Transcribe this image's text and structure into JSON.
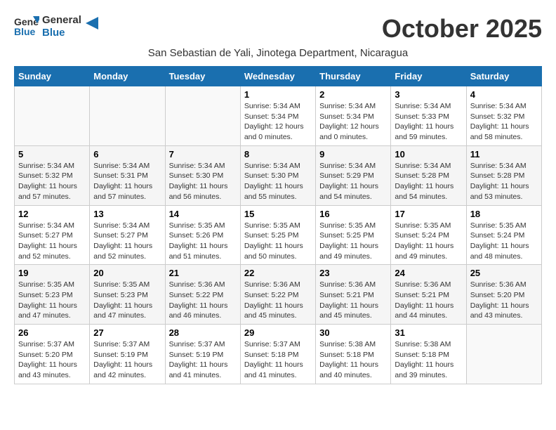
{
  "header": {
    "logo_general": "General",
    "logo_blue": "Blue",
    "month_title": "October 2025",
    "subtitle": "San Sebastian de Yali, Jinotega Department, Nicaragua"
  },
  "weekdays": [
    "Sunday",
    "Monday",
    "Tuesday",
    "Wednesday",
    "Thursday",
    "Friday",
    "Saturday"
  ],
  "weeks": [
    [
      {
        "day": "",
        "info": ""
      },
      {
        "day": "",
        "info": ""
      },
      {
        "day": "",
        "info": ""
      },
      {
        "day": "1",
        "info": "Sunrise: 5:34 AM\nSunset: 5:34 PM\nDaylight: 12 hours\nand 0 minutes."
      },
      {
        "day": "2",
        "info": "Sunrise: 5:34 AM\nSunset: 5:34 PM\nDaylight: 12 hours\nand 0 minutes."
      },
      {
        "day": "3",
        "info": "Sunrise: 5:34 AM\nSunset: 5:33 PM\nDaylight: 11 hours\nand 59 minutes."
      },
      {
        "day": "4",
        "info": "Sunrise: 5:34 AM\nSunset: 5:32 PM\nDaylight: 11 hours\nand 58 minutes."
      }
    ],
    [
      {
        "day": "5",
        "info": "Sunrise: 5:34 AM\nSunset: 5:32 PM\nDaylight: 11 hours\nand 57 minutes."
      },
      {
        "day": "6",
        "info": "Sunrise: 5:34 AM\nSunset: 5:31 PM\nDaylight: 11 hours\nand 57 minutes."
      },
      {
        "day": "7",
        "info": "Sunrise: 5:34 AM\nSunset: 5:30 PM\nDaylight: 11 hours\nand 56 minutes."
      },
      {
        "day": "8",
        "info": "Sunrise: 5:34 AM\nSunset: 5:30 PM\nDaylight: 11 hours\nand 55 minutes."
      },
      {
        "day": "9",
        "info": "Sunrise: 5:34 AM\nSunset: 5:29 PM\nDaylight: 11 hours\nand 54 minutes."
      },
      {
        "day": "10",
        "info": "Sunrise: 5:34 AM\nSunset: 5:28 PM\nDaylight: 11 hours\nand 54 minutes."
      },
      {
        "day": "11",
        "info": "Sunrise: 5:34 AM\nSunset: 5:28 PM\nDaylight: 11 hours\nand 53 minutes."
      }
    ],
    [
      {
        "day": "12",
        "info": "Sunrise: 5:34 AM\nSunset: 5:27 PM\nDaylight: 11 hours\nand 52 minutes."
      },
      {
        "day": "13",
        "info": "Sunrise: 5:34 AM\nSunset: 5:27 PM\nDaylight: 11 hours\nand 52 minutes."
      },
      {
        "day": "14",
        "info": "Sunrise: 5:35 AM\nSunset: 5:26 PM\nDaylight: 11 hours\nand 51 minutes."
      },
      {
        "day": "15",
        "info": "Sunrise: 5:35 AM\nSunset: 5:25 PM\nDaylight: 11 hours\nand 50 minutes."
      },
      {
        "day": "16",
        "info": "Sunrise: 5:35 AM\nSunset: 5:25 PM\nDaylight: 11 hours\nand 49 minutes."
      },
      {
        "day": "17",
        "info": "Sunrise: 5:35 AM\nSunset: 5:24 PM\nDaylight: 11 hours\nand 49 minutes."
      },
      {
        "day": "18",
        "info": "Sunrise: 5:35 AM\nSunset: 5:24 PM\nDaylight: 11 hours\nand 48 minutes."
      }
    ],
    [
      {
        "day": "19",
        "info": "Sunrise: 5:35 AM\nSunset: 5:23 PM\nDaylight: 11 hours\nand 47 minutes."
      },
      {
        "day": "20",
        "info": "Sunrise: 5:35 AM\nSunset: 5:23 PM\nDaylight: 11 hours\nand 47 minutes."
      },
      {
        "day": "21",
        "info": "Sunrise: 5:36 AM\nSunset: 5:22 PM\nDaylight: 11 hours\nand 46 minutes."
      },
      {
        "day": "22",
        "info": "Sunrise: 5:36 AM\nSunset: 5:22 PM\nDaylight: 11 hours\nand 45 minutes."
      },
      {
        "day": "23",
        "info": "Sunrise: 5:36 AM\nSunset: 5:21 PM\nDaylight: 11 hours\nand 45 minutes."
      },
      {
        "day": "24",
        "info": "Sunrise: 5:36 AM\nSunset: 5:21 PM\nDaylight: 11 hours\nand 44 minutes."
      },
      {
        "day": "25",
        "info": "Sunrise: 5:36 AM\nSunset: 5:20 PM\nDaylight: 11 hours\nand 43 minutes."
      }
    ],
    [
      {
        "day": "26",
        "info": "Sunrise: 5:37 AM\nSunset: 5:20 PM\nDaylight: 11 hours\nand 43 minutes."
      },
      {
        "day": "27",
        "info": "Sunrise: 5:37 AM\nSunset: 5:19 PM\nDaylight: 11 hours\nand 42 minutes."
      },
      {
        "day": "28",
        "info": "Sunrise: 5:37 AM\nSunset: 5:19 PM\nDaylight: 11 hours\nand 41 minutes."
      },
      {
        "day": "29",
        "info": "Sunrise: 5:37 AM\nSunset: 5:18 PM\nDaylight: 11 hours\nand 41 minutes."
      },
      {
        "day": "30",
        "info": "Sunrise: 5:38 AM\nSunset: 5:18 PM\nDaylight: 11 hours\nand 40 minutes."
      },
      {
        "day": "31",
        "info": "Sunrise: 5:38 AM\nSunset: 5:18 PM\nDaylight: 11 hours\nand 39 minutes."
      },
      {
        "day": "",
        "info": ""
      }
    ]
  ]
}
